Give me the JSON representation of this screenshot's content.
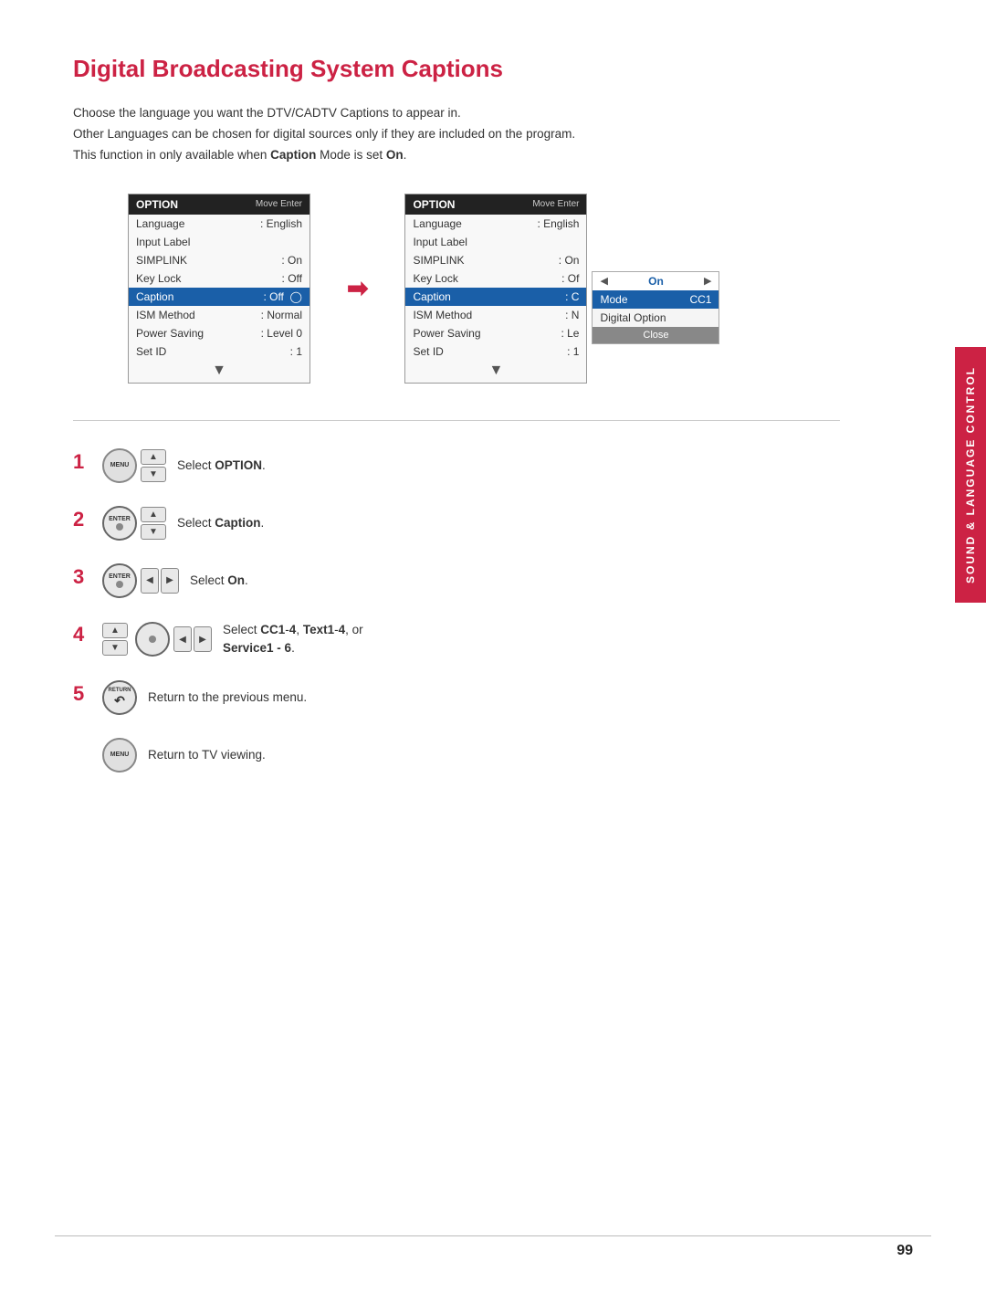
{
  "page": {
    "title": "Digital Broadcasting System Captions",
    "page_number": "99"
  },
  "intro": {
    "line1": "Choose the language you want the DTV/CADTV Captions to appear in.",
    "line2": "Other Languages can be chosen for digital sources only if they are included on the program.",
    "line3_pre": "This function in only available when ",
    "line3_bold": "Caption",
    "line3_post": " Mode is set ",
    "line3_on": "On",
    "line3_period": "."
  },
  "left_menu": {
    "title": "OPTION",
    "controls": "Move   Enter",
    "rows": [
      {
        "label": "Language",
        "value": ": English"
      },
      {
        "label": "Input Label",
        "value": ""
      },
      {
        "label": "SIMPLINK",
        "value": ": On"
      },
      {
        "label": "Key Lock",
        "value": ": Off"
      },
      {
        "label": "Caption",
        "value": ": Off",
        "highlighted": true
      },
      {
        "label": "ISM Method",
        "value": ": Normal"
      },
      {
        "label": "Power Saving",
        "value": ": Level 0"
      },
      {
        "label": "Set ID",
        "value": ": 1"
      }
    ]
  },
  "right_menu": {
    "title": "OPTION",
    "controls": "Move   Enter",
    "rows": [
      {
        "label": "Language",
        "value": ": English"
      },
      {
        "label": "Input Label",
        "value": ""
      },
      {
        "label": "SIMPLINK",
        "value": ": On"
      },
      {
        "label": "Key Lock",
        "value": ": Of"
      },
      {
        "label": "Caption",
        "value": ": C",
        "highlighted": true
      },
      {
        "label": "ISM Method",
        "value": ": N"
      },
      {
        "label": "Power Saving",
        "value": ": Le"
      },
      {
        "label": "Set ID",
        "value": ": 1"
      }
    ]
  },
  "popup": {
    "on_label": "On",
    "mode_label": "Mode",
    "mode_value": "CC1",
    "digital_option": "Digital Option",
    "close": "Close"
  },
  "steps": [
    {
      "number": "1",
      "text_pre": "Select ",
      "text_bold": "OPTION",
      "text_post": "."
    },
    {
      "number": "2",
      "text_pre": "Select ",
      "text_bold": "Caption",
      "text_post": "."
    },
    {
      "number": "3",
      "text_pre": "Select ",
      "text_bold": "On",
      "text_post": "."
    },
    {
      "number": "4",
      "text_pre": "Select ",
      "text_bold": "CC1",
      "text_mid": "-",
      "text_bold2": "4",
      "text_comma": ", ",
      "text_bold3": "Text1",
      "text_mid2": "-",
      "text_bold4": "4",
      "text_comma2": ", or",
      "text_newline": "Service1 - 6."
    },
    {
      "number": "5",
      "text": "Return to the previous menu."
    },
    {
      "number": "",
      "text": "Return to TV viewing."
    }
  ],
  "side_tab": {
    "label": "Sound & Language Control"
  },
  "buttons": {
    "menu_label": "MENU",
    "enter_label": "ENTER",
    "return_label": "RETURN"
  }
}
